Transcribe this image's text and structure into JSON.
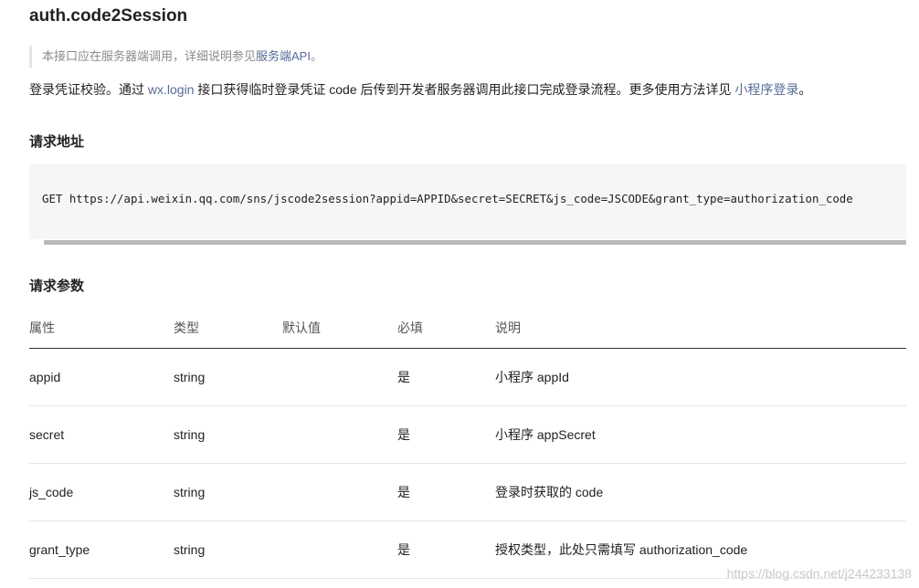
{
  "title": "auth.code2Session",
  "note": {
    "text": "本接口应在服务器端调用，详细说明参见",
    "link": "服务端API",
    "suffix": "。"
  },
  "intro": {
    "p1": "登录凭证校验。通过 ",
    "link1": "wx.login",
    "p2": " 接口获得临时登录凭证 code 后传到开发者服务器调用此接口完成登录流程。更多使用方法详见 ",
    "link2": "小程序登录",
    "p3": "。"
  },
  "request_url": {
    "heading": "请求地址",
    "code": "GET https://api.weixin.qq.com/sns/jscode2session?appid=APPID&secret=SECRET&js_code=JSCODE&grant_type=authorization_code"
  },
  "request_params": {
    "heading": "请求参数",
    "columns": [
      "属性",
      "类型",
      "默认值",
      "必填",
      "说明"
    ],
    "rows": [
      [
        "appid",
        "string",
        "",
        "是",
        "小程序 appId"
      ],
      [
        "secret",
        "string",
        "",
        "是",
        "小程序 appSecret"
      ],
      [
        "js_code",
        "string",
        "",
        "是",
        "登录时获取的 code"
      ],
      [
        "grant_type",
        "string",
        "",
        "是",
        "授权类型，此处只需填写 authorization_code"
      ]
    ]
  },
  "watermark": "https://blog.csdn.net/j244233138"
}
